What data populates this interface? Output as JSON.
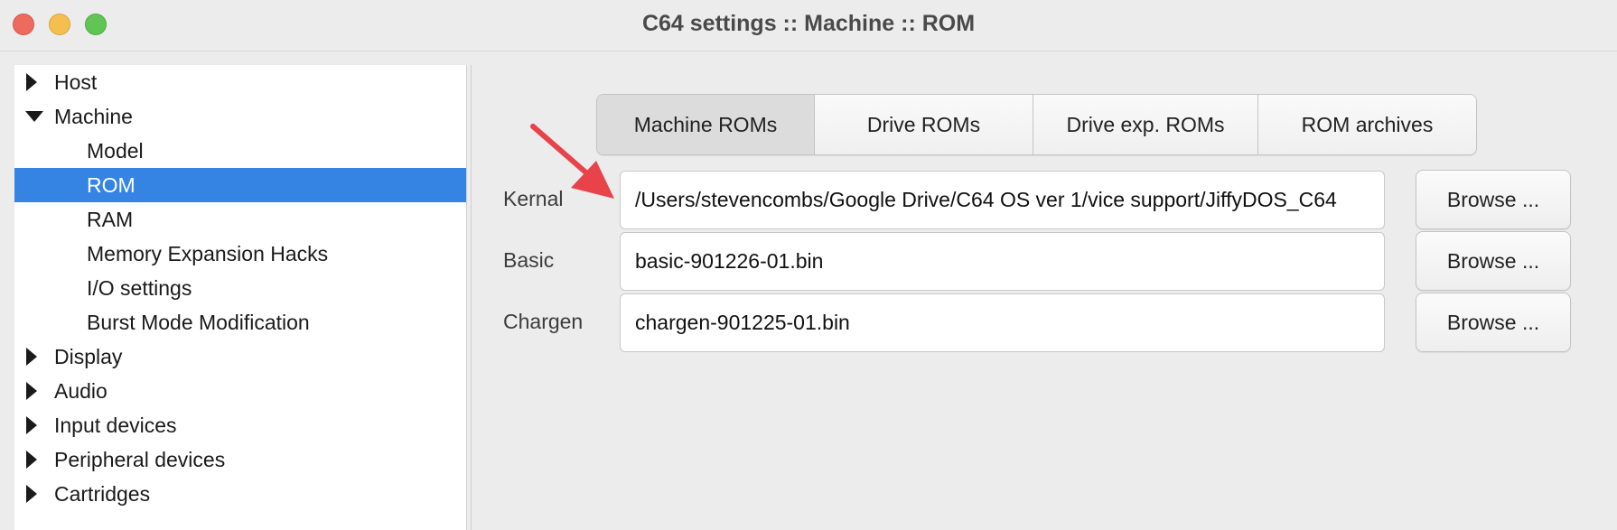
{
  "window": {
    "title": "C64 settings :: Machine :: ROM"
  },
  "sidebar": {
    "items": [
      {
        "label": "Host",
        "level": 0,
        "expanded": false
      },
      {
        "label": "Machine",
        "level": 0,
        "expanded": true
      },
      {
        "label": "Model",
        "level": 1
      },
      {
        "label": "ROM",
        "level": 1,
        "selected": true
      },
      {
        "label": "RAM",
        "level": 1
      },
      {
        "label": "Memory Expansion Hacks",
        "level": 1
      },
      {
        "label": "I/O settings",
        "level": 1
      },
      {
        "label": "Burst Mode Modification",
        "level": 1
      },
      {
        "label": "Display",
        "level": 0,
        "expanded": false
      },
      {
        "label": "Audio",
        "level": 0,
        "expanded": false
      },
      {
        "label": "Input devices",
        "level": 0,
        "expanded": false
      },
      {
        "label": "Peripheral devices",
        "level": 0,
        "expanded": false
      },
      {
        "label": "Cartridges",
        "level": 0,
        "expanded": false
      }
    ]
  },
  "tabs": [
    {
      "label": "Machine ROMs",
      "active": true
    },
    {
      "label": "Drive ROMs"
    },
    {
      "label": "Drive exp. ROMs"
    },
    {
      "label": "ROM archives"
    }
  ],
  "roms": {
    "kernal": {
      "label": "Kernal",
      "value": "/Users/stevencombs/Google Drive/C64 OS ver 1/vice support/JiffyDOS_C64",
      "browse": "Browse ..."
    },
    "basic": {
      "label": "Basic",
      "value": "basic-901226-01.bin",
      "browse": "Browse ..."
    },
    "chargen": {
      "label": "Chargen",
      "value": "chargen-901225-01.bin",
      "browse": "Browse ..."
    }
  },
  "colors": {
    "selection": "#3584e4",
    "annotation_arrow": "#e8424a",
    "close": "#ed6a5e",
    "minimize": "#f5bf4f",
    "zoom": "#61c554"
  },
  "icons": {
    "collapsed": "triangle-right-icon",
    "expanded": "triangle-down-icon"
  }
}
